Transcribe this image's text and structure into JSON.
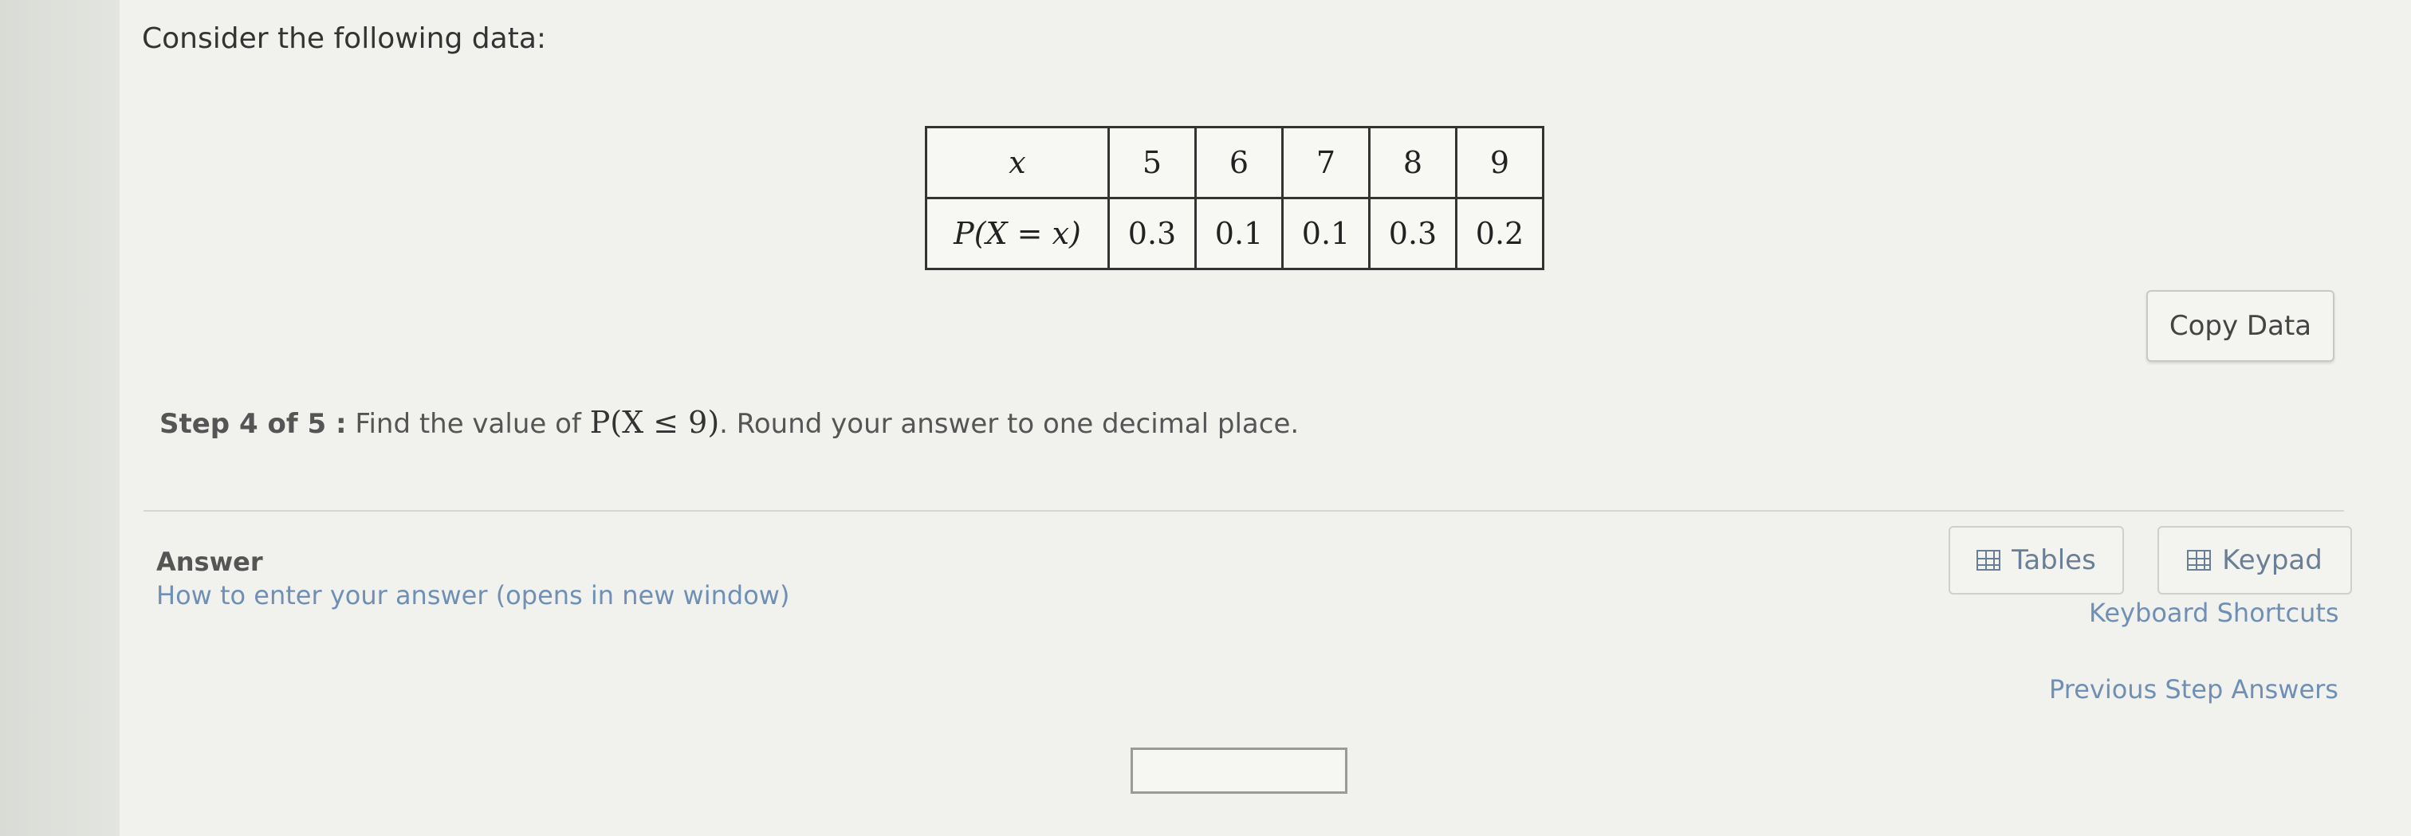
{
  "question": {
    "prompt": "Consider the following data:"
  },
  "table": {
    "row_labels": [
      "x",
      "P(X = x)"
    ],
    "x_values": [
      "5",
      "6",
      "7",
      "8",
      "9"
    ],
    "probabilities": [
      "0.3",
      "0.1",
      "0.1",
      "0.3",
      "0.2"
    ]
  },
  "copy_button": {
    "label": "Copy Data"
  },
  "step": {
    "label": "Step 4 of 5 :",
    "text_before": "Find the value of",
    "expression": "P(X ≤ 9)",
    "text_after": ". Round your answer to one decimal place."
  },
  "answer": {
    "label": "Answer",
    "help_link": "How to enter your answer (opens in new window)",
    "input_value": ""
  },
  "tools": {
    "tables_label": "Tables",
    "keypad_label": "Keypad",
    "tables_icon": "table-icon",
    "keypad_icon": "keypad-icon",
    "shortcuts_label": "Keyboard Shortcuts",
    "previous_answers_label": "Previous Step Answers"
  }
}
